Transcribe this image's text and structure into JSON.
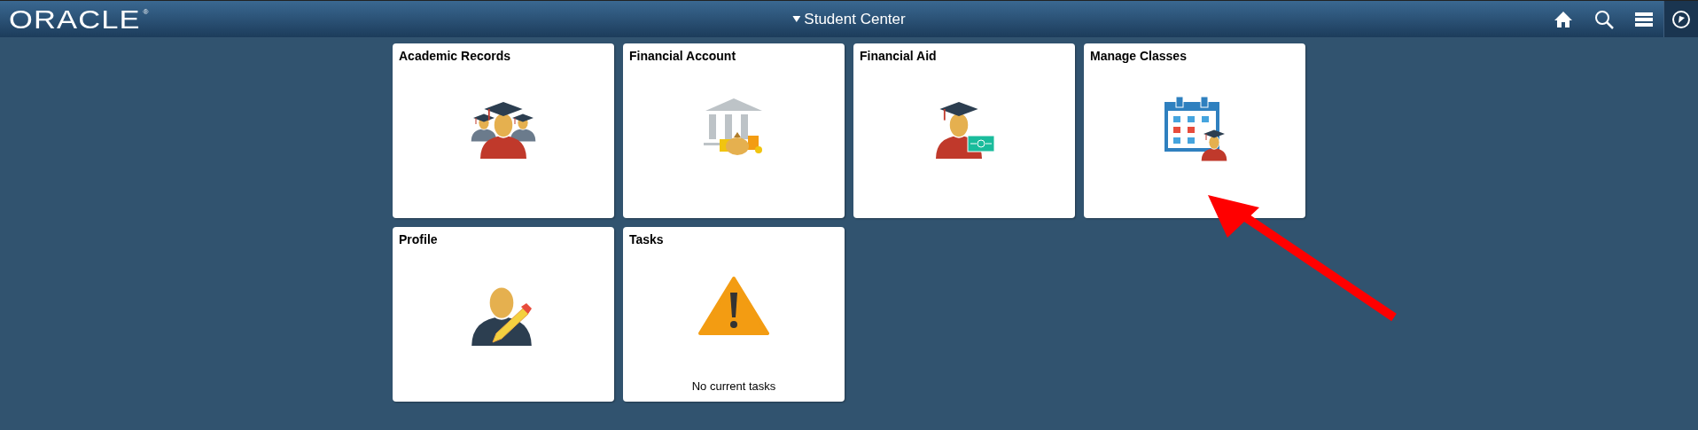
{
  "header": {
    "logo": "ORACLE",
    "logo_mark": "®",
    "title": "Student Center"
  },
  "tiles": [
    {
      "title": "Academic Records",
      "kind": "graduates"
    },
    {
      "title": "Financial Account",
      "kind": "bank"
    },
    {
      "title": "Financial Aid",
      "kind": "aid"
    },
    {
      "title": "Manage Classes",
      "kind": "calendar"
    },
    {
      "title": "Profile",
      "kind": "profile"
    },
    {
      "title": "Tasks",
      "kind": "warning",
      "footer": "No current tasks"
    }
  ]
}
